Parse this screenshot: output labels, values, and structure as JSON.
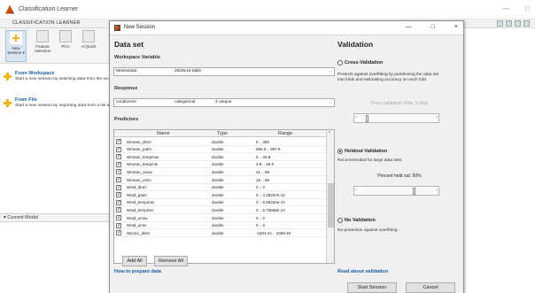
{
  "app": {
    "title": "Classification Learner",
    "window_controls": [
      "—",
      "□",
      "×"
    ],
    "ribbon_tab": "CLASSIFICATION LEARNER",
    "ribbon": {
      "new_session": "New Session ▾",
      "feature_selection": "Feature Selection",
      "pca": "PCA",
      "quick": "Al Quick"
    },
    "start_items": [
      {
        "title": "From Workspace",
        "desc": "Start a new session by selecting data from the workspace and specifying a valid"
      },
      {
        "title": "From File",
        "desc": "Start a new session by importing data from a file and specifying a validation"
      }
    ],
    "current_model": "▾ Current Model"
  },
  "dialog": {
    "title": "New Session",
    "controls": [
      "—",
      "□",
      "×"
    ],
    "data_set": {
      "heading": "Data set",
      "workspace_label": "Workspace Variable",
      "workspace_var": {
        "name": "MeteoData",
        "info": "2929x19 table"
      },
      "response_label": "Response",
      "response": {
        "name": "condizione",
        "type": "categorical",
        "info": "4 unique"
      },
      "predictors_label": "Predictors",
      "columns": [
        "Name",
        "Type",
        "Range"
      ],
      "rows": [
        {
          "name": "Wmean_direz",
          "type": "double",
          "range": "0 .. 360"
        },
        {
          "name": "Wmean_patm",
          "type": "double",
          "range": "955.8 .. 997.9"
        },
        {
          "name": "Wmean_tempmax",
          "type": "double",
          "range": "6 .. 26.8"
        },
        {
          "name": "Wmean_tempmin",
          "type": "double",
          "range": "4.8 .. 25.9"
        },
        {
          "name": "Wmean_umax",
          "type": "double",
          "range": "21 .. 98"
        },
        {
          "name": "Wmean_umin",
          "type": "double",
          "range": "18 .. 96"
        },
        {
          "name": "Wstd_direz",
          "type": "double",
          "range": "0 .. 0"
        },
        {
          "name": "Wstd_patm",
          "type": "double",
          "range": "0 .. 2.28267e-12"
        },
        {
          "name": "Wstd_tempmax",
          "type": "double",
          "range": "0 .. 6.06334e-14"
        },
        {
          "name": "Wstd_tempmin",
          "type": "double",
          "range": "0 .. 5.70668e-14"
        },
        {
          "name": "Wstd_umax",
          "type": "double",
          "range": "0 .. 0"
        },
        {
          "name": "Wstd_umin",
          "type": "double",
          "range": "0 .. 0"
        },
        {
          "name": "Wpca1_direz",
          "type": "double",
          "range": "-1603.44 .. 2469.49"
        }
      ],
      "add_all": "Add All",
      "remove_all": "Remove All",
      "how_to_prepare": "How to prepare data"
    },
    "validation": {
      "heading": "Validation",
      "cross": {
        "label": "Cross-Validation",
        "desc_lines": [
          "Protects against overfitting by partitioning the data set",
          "into folds and estimating accuracy on each fold."
        ],
        "slider_label": "Cross-validation folds: 5 folds",
        "folds": 5
      },
      "holdout": {
        "label": "Holdout Validation",
        "desc": "Recommended for large data sets.",
        "slider_label": "Percent held out: 50%",
        "percent": 50
      },
      "none": {
        "label": "No Validation",
        "desc": "No protection against overfitting."
      },
      "selected": "holdout",
      "read_about": "Read about validation"
    },
    "start_session": "Start Session",
    "cancel": "Cancel"
  }
}
